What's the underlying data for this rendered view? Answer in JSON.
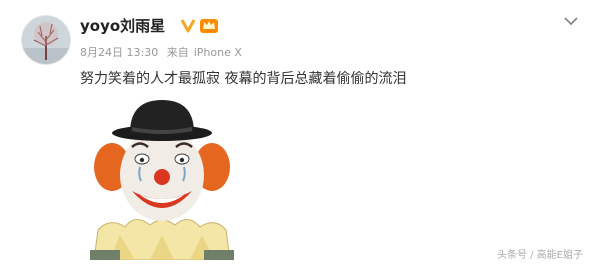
{
  "post": {
    "username": "yoyo刘雨星",
    "timestamp": "8月24日 13:30",
    "source_prefix": "来自",
    "device": "iPhone X",
    "text": "努力笑着的人才最孤寂  夜幕的背后总藏着偷偷的流泪"
  },
  "icons": {
    "verified": "verified-v-icon",
    "vip": "vip-crown-icon",
    "menu": "chevron-down-icon"
  },
  "watermark": "头条号 / 高能E姐子",
  "colors": {
    "verified": "#f5a623",
    "vip": "#ff7a00",
    "meta": "#999999"
  }
}
